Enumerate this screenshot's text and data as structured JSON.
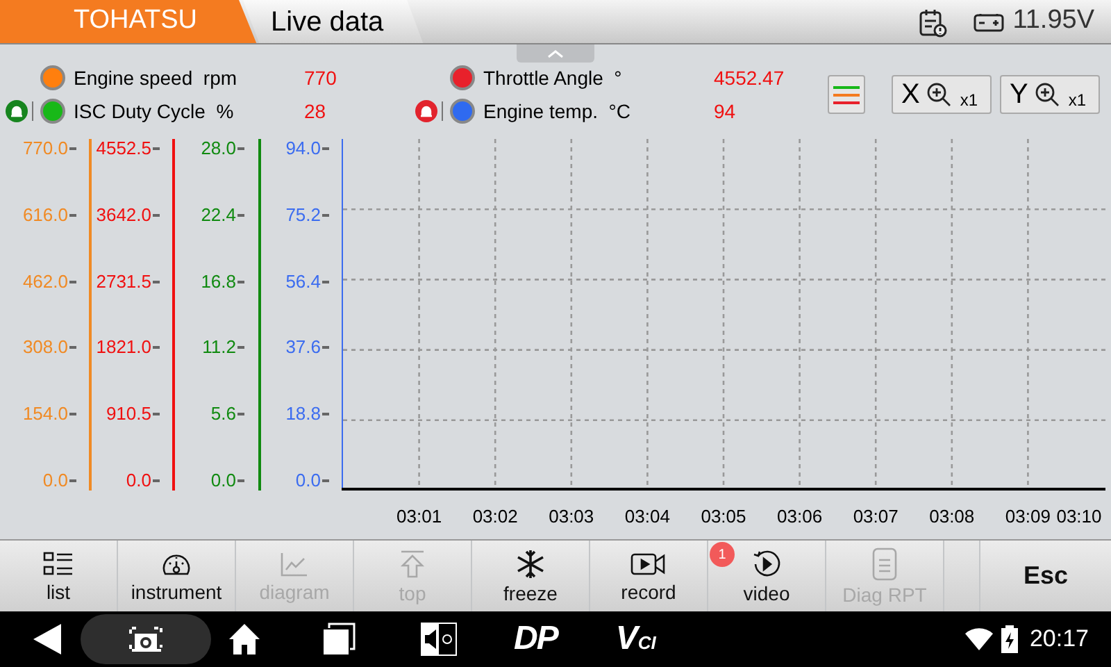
{
  "header": {
    "brand_tab": "TOHATSU",
    "page_tab": "Live data",
    "voltage": "11.95V"
  },
  "legend": [
    {
      "name": "Engine speed  rpm",
      "value": "770",
      "color": "#ff7f0e"
    },
    {
      "name": "Throttle Angle  °",
      "value": "4552.47",
      "color": "#e8212b"
    },
    {
      "name": "ISC Duty Cycle  %",
      "value": "28",
      "color": "#18b818",
      "kind": "alarmok"
    },
    {
      "name": "Engine temp.  °C",
      "value": "94",
      "color": "#2f6af0",
      "kind": "alarmhigh"
    }
  ],
  "zoom_buttons": [
    {
      "axis": "X",
      "factor": "x1"
    },
    {
      "axis": "Y",
      "factor": "x1"
    }
  ],
  "y_axes": [
    {
      "color": "#f08a24",
      "labels": [
        "770.0",
        "616.0",
        "462.0",
        "308.0",
        "154.0",
        "0.0"
      ]
    },
    {
      "color": "#f01010",
      "labels": [
        "4552.5",
        "3642.0",
        "2731.5",
        "1821.0",
        "910.5",
        "0.0"
      ]
    },
    {
      "color": "#108a10",
      "labels": [
        "28.0",
        "22.4",
        "16.8",
        "11.2",
        "5.6",
        "0.0"
      ]
    },
    {
      "color": "#3b6cf0",
      "labels": [
        "94.0",
        "75.2",
        "56.4",
        "37.6",
        "18.8",
        "0.0"
      ]
    }
  ],
  "x_labels": [
    "03:01",
    "03:02",
    "03:03",
    "03:04",
    "03:05",
    "03:06",
    "03:07",
    "03:08",
    "03:09",
    "03:10"
  ],
  "toolbar": [
    {
      "kind": "list",
      "label": "list",
      "disabled": false
    },
    {
      "kind": "gauge",
      "label": "instrument",
      "disabled": false
    },
    {
      "kind": "chart",
      "label": "diagram",
      "disabled": true
    },
    {
      "kind": "top",
      "label": "top",
      "disabled": true
    },
    {
      "kind": "snow",
      "label": "freeze",
      "disabled": false
    },
    {
      "kind": "camera",
      "label": "record",
      "disabled": false
    },
    {
      "kind": "play",
      "label": "video",
      "disabled": false,
      "badge": "1"
    },
    {
      "kind": "doc",
      "label": "Diag RPT",
      "disabled": true
    },
    {
      "kind": "blank"
    },
    {
      "kind": "text",
      "label": "Esc",
      "disabled": false
    }
  ],
  "nav": {
    "logo_1": "DP",
    "logo_2_big": "V",
    "logo_2_small": "CI",
    "time": "20:17"
  }
}
